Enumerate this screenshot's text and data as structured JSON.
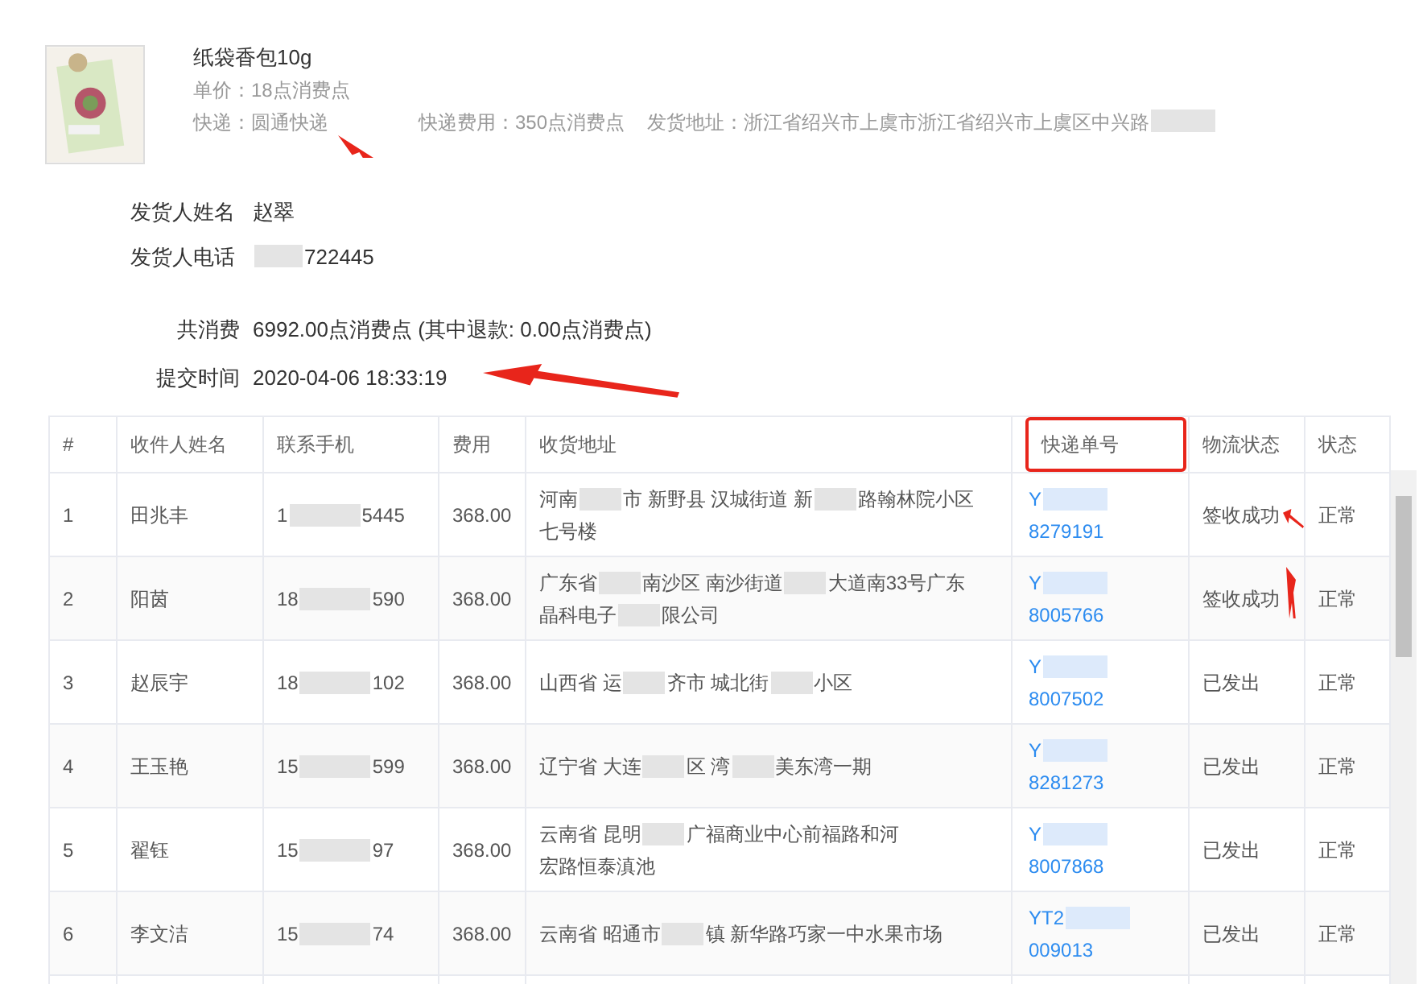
{
  "product": {
    "name": "纸袋香包10g",
    "unit_price": "单价：18点消费点",
    "courier": "快递：圆通快递",
    "shipping_fee": "快递费用：350点消费点",
    "ship_address": "发货地址：浙江省绍兴市上虞市浙江省绍兴市上虞区中兴路"
  },
  "sender": [
    {
      "label": "发货人姓名",
      "value": "赵翠",
      "masked": false
    },
    {
      "label": "发货人电话",
      "value": "722445",
      "masked": true
    }
  ],
  "summary": [
    {
      "label": "共消费",
      "value": "6992.00点消费点 (其中退款: 0.00点消费点)"
    },
    {
      "label": "提交时间",
      "value": "2020-04-06 18:33:19"
    }
  ],
  "table": {
    "columns": [
      {
        "label": "#",
        "highlighted": false
      },
      {
        "label": "收件人姓名",
        "highlighted": false
      },
      {
        "label": "联系手机",
        "highlighted": false
      },
      {
        "label": "费用",
        "highlighted": false
      },
      {
        "label": "收货地址",
        "highlighted": false
      },
      {
        "label": "快递单号",
        "highlighted": true
      },
      {
        "label": "物流状态",
        "highlighted": false
      },
      {
        "label": "状态",
        "highlighted": false
      }
    ],
    "rows": [
      {
        "index": "1",
        "name": "田兆丰",
        "phone": [
          "1",
          "5445"
        ],
        "fee": "368.00",
        "address": [
          [
            "河南",
            "市 新野县 汉城街道 新",
            "路翰林院小区"
          ],
          [
            "七号楼"
          ]
        ],
        "tracking": [
          "Y",
          "8279191"
        ],
        "logistics": "签收成功",
        "status": "正常",
        "arrow": true
      },
      {
        "index": "2",
        "name": "阳茵",
        "phone": [
          "18",
          "590"
        ],
        "fee": "368.00",
        "address": [
          [
            "广东省",
            "南沙区 南沙街道",
            "大道南33号广东"
          ],
          [
            "晶科电子",
            "限公司"
          ]
        ],
        "tracking": [
          "Y",
          "8005766"
        ],
        "logistics": "签收成功",
        "status": "正常",
        "arrow": true
      },
      {
        "index": "3",
        "name": "赵辰宇",
        "phone": [
          "18",
          "102"
        ],
        "fee": "368.00",
        "address": [
          [
            "山西省 运",
            "齐市 城北街",
            "小区"
          ]
        ],
        "tracking": [
          "Y",
          "8007502"
        ],
        "logistics": "已发出",
        "status": "正常",
        "arrow": false
      },
      {
        "index": "4",
        "name": "王玉艳",
        "phone": [
          "15",
          "599"
        ],
        "fee": "368.00",
        "address": [
          [
            "辽宁省 大连",
            "区 湾",
            "美东湾一期"
          ]
        ],
        "tracking": [
          "Y",
          "8281273"
        ],
        "logistics": "已发出",
        "status": "正常",
        "arrow": false
      },
      {
        "index": "5",
        "name": "翟钰",
        "phone": [
          "15",
          "97"
        ],
        "fee": "368.00",
        "address": [
          [
            "云南省 昆明",
            "广福商业中心前福路和河"
          ],
          [
            "宏路恒泰滇池"
          ]
        ],
        "tracking": [
          "Y",
          "8007868"
        ],
        "logistics": "已发出",
        "status": "正常",
        "arrow": false
      },
      {
        "index": "6",
        "name": "李文洁",
        "phone": [
          "15",
          "74"
        ],
        "fee": "368.00",
        "address": [
          [
            "云南省 昭通市",
            "镇 新华路巧家一中水果市场"
          ]
        ],
        "tracking": [
          "YT2",
          "009013"
        ],
        "logistics": "已发出",
        "status": "正常",
        "arrow": false
      }
    ]
  }
}
